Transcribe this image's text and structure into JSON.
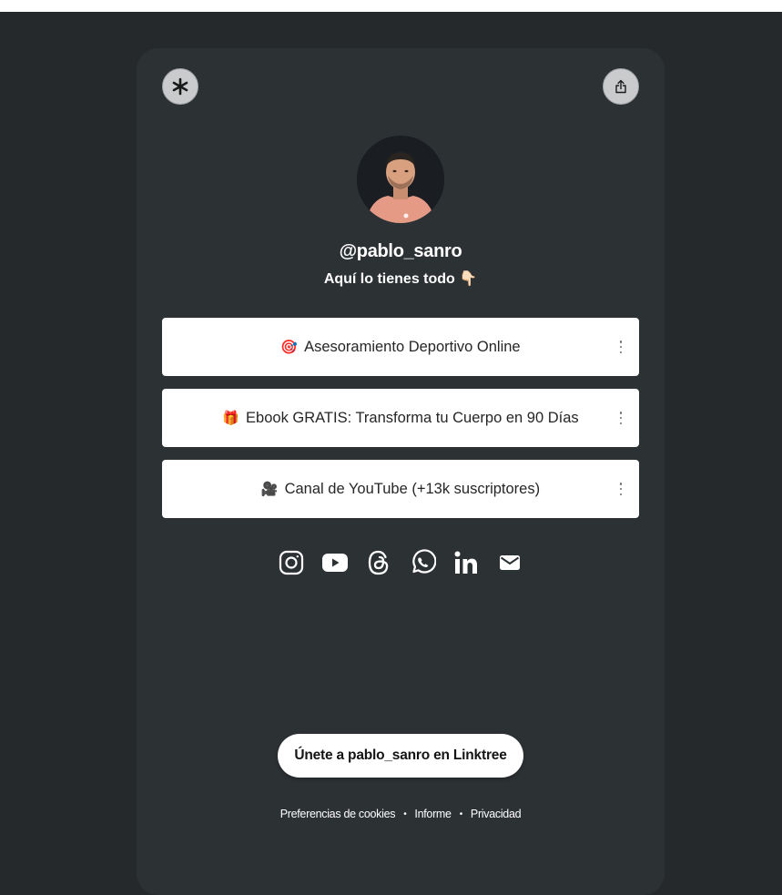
{
  "profile": {
    "handle": "@pablo_sanro",
    "bio": "Aquí lo tienes todo 👇🏻"
  },
  "links": [
    {
      "emoji": "🎯",
      "label": "Asesoramiento Deportivo Online"
    },
    {
      "emoji": "🎁",
      "label": "Ebook GRATIS: Transforma tu Cuerpo en 90 Días"
    },
    {
      "emoji": "🎥",
      "label": "Canal de YouTube (+13k suscriptores)"
    }
  ],
  "socials": [
    "instagram-icon",
    "youtube-icon",
    "threads-icon",
    "whatsapp-icon",
    "linkedin-icon",
    "email-icon"
  ],
  "join_label": "Únete a pablo_sanro en Linktree",
  "footer": {
    "cookies": "Preferencias de cookies",
    "separator": "•",
    "report": "Informe",
    "privacy": "Privacidad"
  },
  "colors": {
    "page_background": "#25292c",
    "card_background": "#2c3134",
    "link_background": "#ffffff",
    "text_on_dark": "#ffffff"
  }
}
